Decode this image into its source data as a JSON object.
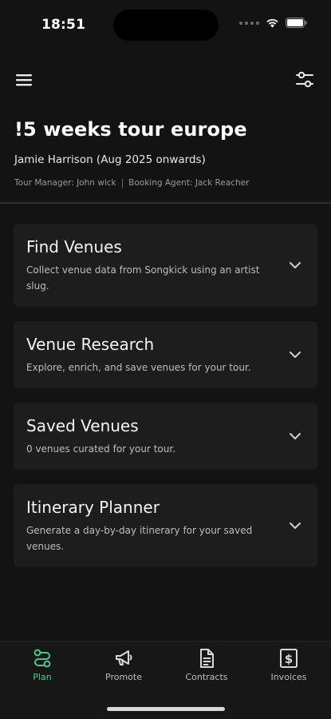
{
  "status_bar": {
    "time": "18:51"
  },
  "tour": {
    "title": "!5 weeks tour europe",
    "subtitle": "Jamie Harrison (Aug 2025 onwards)",
    "tour_manager": "Tour Manager: John wick",
    "separator": "|",
    "booking_agent": "Booking Agent: Jack Reacher"
  },
  "cards": [
    {
      "title": "Find Venues",
      "description": "Collect venue data from Songkick using an artist slug."
    },
    {
      "title": "Venue Research",
      "description": "Explore, enrich, and save venues for your tour."
    },
    {
      "title": "Saved Venues",
      "description": "0 venues curated for your tour."
    },
    {
      "title": "Itinerary Planner",
      "description": "Generate a day-by-day itinerary for your saved venues."
    }
  ],
  "nav": {
    "items": [
      {
        "label": "Plan",
        "icon": "route-icon",
        "active": true
      },
      {
        "label": "Promote",
        "icon": "megaphone-icon",
        "active": false
      },
      {
        "label": "Contracts",
        "icon": "document-icon",
        "active": false
      },
      {
        "label": "Invoices",
        "icon": "invoice-dollar-icon",
        "active": false
      }
    ]
  },
  "colors": {
    "accent": "#4fc98a",
    "background": "#131313",
    "card": "#1d1d1d"
  }
}
